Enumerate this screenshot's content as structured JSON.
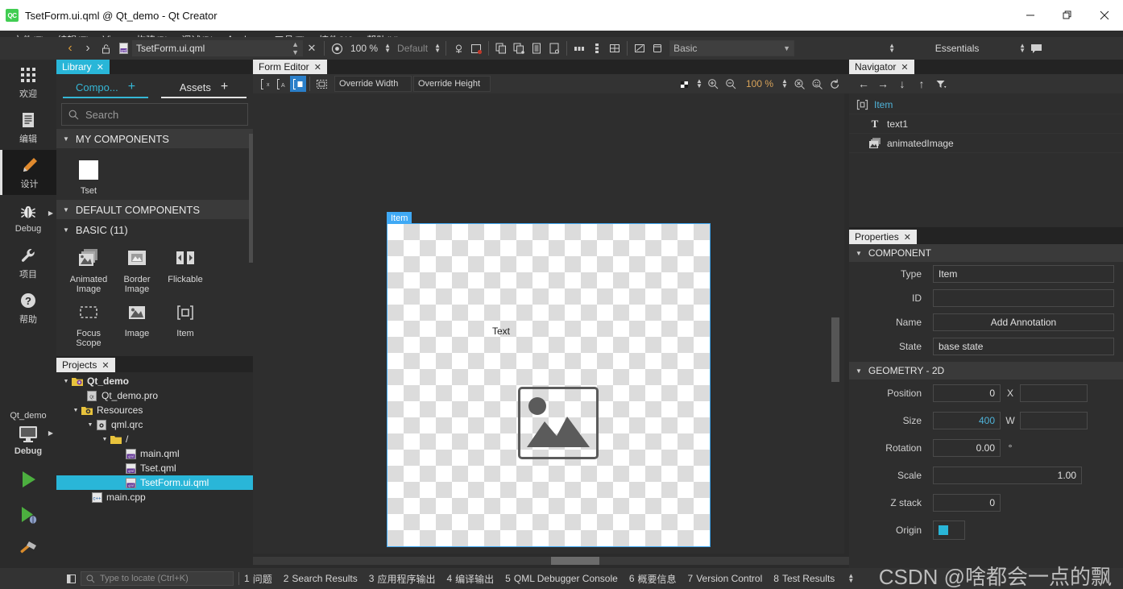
{
  "window": {
    "title": "TsetForm.ui.qml @ Qt_demo - Qt Creator",
    "logo_text": "QC",
    "minimize": "—",
    "maximize": "❐",
    "close": "✕"
  },
  "menubar": {
    "items": [
      {
        "label": "文件(F)"
      },
      {
        "label": "编辑(E)"
      },
      {
        "label": "View"
      },
      {
        "label": "构建(B)"
      },
      {
        "label": "调试(D)"
      },
      {
        "label": "Analyze"
      },
      {
        "label": "工具(T)"
      },
      {
        "label": "控件(W)"
      },
      {
        "label": "帮助(H)"
      }
    ]
  },
  "toolbar": {
    "back": "‹",
    "forward": "›",
    "lock_icon": "unlock-icon",
    "file_icon_label": "qml",
    "file_combo_value": "TsetForm.ui.qml",
    "close_doc": "✕",
    "preview_icon": "circle-play-icon",
    "zoom_value": "100 %",
    "style_value": "Default",
    "annotation_icon": "annotation-icon",
    "reset_icon": "reset-view-icon",
    "align_icons": [
      "copy-formats-icon",
      "paste-formats-icon",
      "select-icon",
      "settings-icon"
    ],
    "layout_icons": [
      "row-layout-icon",
      "column-layout-icon",
      "grid-layout-icon",
      "edit-icon",
      "stack-icon"
    ],
    "style_combo_value": "Basic",
    "workspace_value": "Essentials",
    "chat_icon": "message-icon"
  },
  "modebar": {
    "items": [
      {
        "label": "欢迎",
        "icon": "grid-icon",
        "active": false
      },
      {
        "label": "编辑",
        "icon": "document-icon",
        "active": false
      },
      {
        "label": "设计",
        "icon": "pencil-icon",
        "active": true
      },
      {
        "label": "Debug",
        "icon": "bug-icon",
        "active": false,
        "has_arrow": true
      },
      {
        "label": "项目",
        "icon": "wrench-icon",
        "active": false
      },
      {
        "label": "帮助",
        "icon": "question-icon",
        "active": false
      }
    ],
    "kit_name": "Qt_demo",
    "kit_mode": "Debug",
    "kit_icon": "monitor-icon",
    "run_icon": "run-triangle-icon",
    "debug_icon": "debug-run-icon",
    "build_icon": "hammer-icon"
  },
  "library": {
    "tab_title": "Library",
    "tab_close": "✕",
    "subtabs": [
      {
        "label": "Compo...",
        "plus": "+",
        "selected": true
      },
      {
        "label": "Assets",
        "plus": "+",
        "selected": false
      }
    ],
    "search_placeholder": "Search",
    "search_icon": "search-icon",
    "sections": [
      {
        "title": "MY COMPONENTS",
        "items": [
          {
            "name": "Tset",
            "icon": "blank-square-icon"
          }
        ]
      },
      {
        "title": "DEFAULT COMPONENTS",
        "items": []
      },
      {
        "title": "BASIC (11)",
        "items": [
          {
            "name": "Animated\nImage",
            "icon": "animated-image-icon"
          },
          {
            "name": "Border\nImage",
            "icon": "border-image-icon"
          },
          {
            "name": "Flickable",
            "icon": "flickable-icon"
          },
          {
            "name": "Focus Scope",
            "icon": "focus-scope-icon"
          },
          {
            "name": "Image",
            "icon": "image-icon"
          },
          {
            "name": "Item",
            "icon": "item-icon"
          }
        ]
      }
    ]
  },
  "projects": {
    "tab_title": "Projects",
    "tab_close": "✕",
    "tree": [
      {
        "label": "Qt_demo",
        "depth": 0,
        "icon": "project-icon",
        "bold": true,
        "expander": "▼",
        "selected": false
      },
      {
        "label": "Qt_demo.pro",
        "depth": 1,
        "icon": "pro-file-icon",
        "bold": false,
        "expander": "",
        "selected": false
      },
      {
        "label": "Resources",
        "depth": 1,
        "icon": "resource-icon",
        "bold": false,
        "expander": "▼",
        "selected": false
      },
      {
        "label": "qml.qrc",
        "depth": 2,
        "icon": "qrc-file-icon",
        "bold": false,
        "expander": "▼",
        "selected": false
      },
      {
        "label": "/",
        "depth": 3,
        "icon": "folder-icon",
        "bold": false,
        "expander": "▼",
        "selected": false
      },
      {
        "label": "main.qml",
        "depth": 4,
        "icon": "qml-file-icon",
        "bold": false,
        "expander": "",
        "selected": false
      },
      {
        "label": "Tset.qml",
        "depth": 4,
        "icon": "qml-file-icon",
        "bold": false,
        "expander": "",
        "selected": false
      },
      {
        "label": "TsetForm.ui.qml",
        "depth": 4,
        "icon": "qml-file-icon",
        "bold": false,
        "expander": "",
        "selected": true
      },
      {
        "label": "main.cpp",
        "depth": 1,
        "icon": "cpp-file-icon",
        "bold": false,
        "expander": "",
        "selected": false
      }
    ]
  },
  "form_editor": {
    "tab_title": "Form Editor",
    "tab_close": "✕",
    "tool_buttons": [
      "no-snapping-icon",
      "snap-anchors-icon",
      "snap-items-icon",
      "select-only-icon"
    ],
    "override_width_placeholder": "Override Width",
    "override_height_placeholder": "Override Height",
    "zoom_value": "100 %",
    "zoom_in_icon": "zoom-in-icon",
    "zoom_out_icon": "zoom-out-icon",
    "zoom_reset_icon": "zoom-reset-icon",
    "zoom_fit_icon": "zoom-fit-icon",
    "refresh_icon": "refresh-icon",
    "canvas": {
      "root_label": "Item",
      "text_item": "Text",
      "image_placeholder_icon": "image-placeholder-icon"
    }
  },
  "navigator": {
    "tab_title": "Navigator",
    "tab_close": "✕",
    "toolbar_icons": [
      "arrow-left-icon",
      "arrow-right-icon",
      "arrow-down-icon",
      "arrow-up-icon",
      "filter-icon"
    ],
    "rows": [
      {
        "label": "Item",
        "depth": 0,
        "icon": "item-icon",
        "root": true
      },
      {
        "label": "text1",
        "depth": 1,
        "icon": "text-icon",
        "root": false
      },
      {
        "label": "animatedImage",
        "depth": 1,
        "icon": "animated-image-icon",
        "root": false
      }
    ]
  },
  "properties": {
    "tab_title": "Properties",
    "tab_close": "✕",
    "sections": [
      {
        "title": "COMPONENT",
        "rows": [
          {
            "label": "Type",
            "value": "Item",
            "kind": "text"
          },
          {
            "label": "ID",
            "value": "",
            "kind": "text"
          },
          {
            "label": "Name",
            "value": "Add Annotation",
            "kind": "center"
          },
          {
            "label": "State",
            "value": "base state",
            "kind": "text"
          }
        ]
      },
      {
        "title": "GEOMETRY - 2D",
        "rows": [
          {
            "label": "Position",
            "value": "0",
            "unit": "X",
            "kind": "num",
            "second": ""
          },
          {
            "label": "Size",
            "value": "400",
            "unit": "W",
            "kind": "num-cyan",
            "second": ""
          },
          {
            "label": "Rotation",
            "value": "0.00",
            "unit": "°",
            "kind": "num"
          },
          {
            "label": "Scale",
            "value": "1.00",
            "unit": "",
            "kind": "num-wide"
          },
          {
            "label": "Z stack",
            "value": "0",
            "unit": "",
            "kind": "num"
          },
          {
            "label": "Origin",
            "value": "",
            "unit": "",
            "kind": "origin"
          }
        ]
      }
    ]
  },
  "statusbar": {
    "toggle_icon": "sidebar-toggle-icon",
    "locator_placeholder": "Type to locate (Ctrl+K)",
    "locator_icon": "search-icon",
    "panes": [
      {
        "num": "1",
        "label": "问题"
      },
      {
        "num": "2",
        "label": "Search Results"
      },
      {
        "num": "3",
        "label": "应用程序输出"
      },
      {
        "num": "4",
        "label": "编译输出"
      },
      {
        "num": "5",
        "label": "QML Debugger Console"
      },
      {
        "num": "6",
        "label": "概要信息"
      },
      {
        "num": "7",
        "label": "Version Control"
      },
      {
        "num": "8",
        "label": "Test Results"
      }
    ]
  },
  "watermark": "CSDN @啥都会一点的飘",
  "colors": {
    "accent_cyan": "#29b6d8",
    "selection_blue": "#3fa9f5",
    "toolbar_bg": "#333333",
    "panel_bg": "#2e2e2e",
    "qt_green": "#41cd52"
  }
}
